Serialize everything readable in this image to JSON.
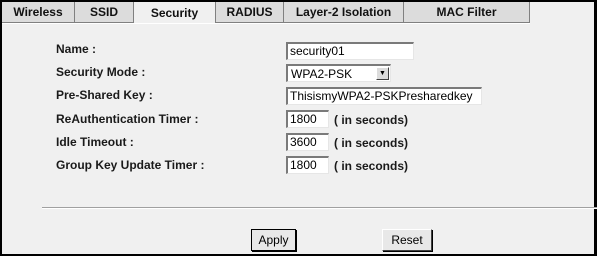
{
  "tabs": [
    {
      "label": "Wireless"
    },
    {
      "label": "SSID"
    },
    {
      "label": "Security"
    },
    {
      "label": "RADIUS"
    },
    {
      "label": "Layer-2 Isolation"
    },
    {
      "label": "MAC Filter"
    }
  ],
  "active_tab": "Security",
  "form": {
    "name_label": "Name :",
    "name_value": "security01",
    "mode_label": "Security Mode :",
    "mode_value": "WPA2-PSK",
    "psk_label": "Pre-Shared Key :",
    "psk_value": "ThisismyWPA2-PSKPresharedkey",
    "reauth_label": "ReAuthentication Timer :",
    "reauth_value": "1800",
    "idle_label": "Idle Timeout :",
    "idle_value": "3600",
    "gkut_label": "Group Key Update Timer :",
    "gkut_value": "1800",
    "unit_label": "( in seconds)"
  },
  "buttons": {
    "apply": "Apply",
    "reset": "Reset"
  },
  "icons": {
    "select_arrow": "chevron-down-icon"
  }
}
